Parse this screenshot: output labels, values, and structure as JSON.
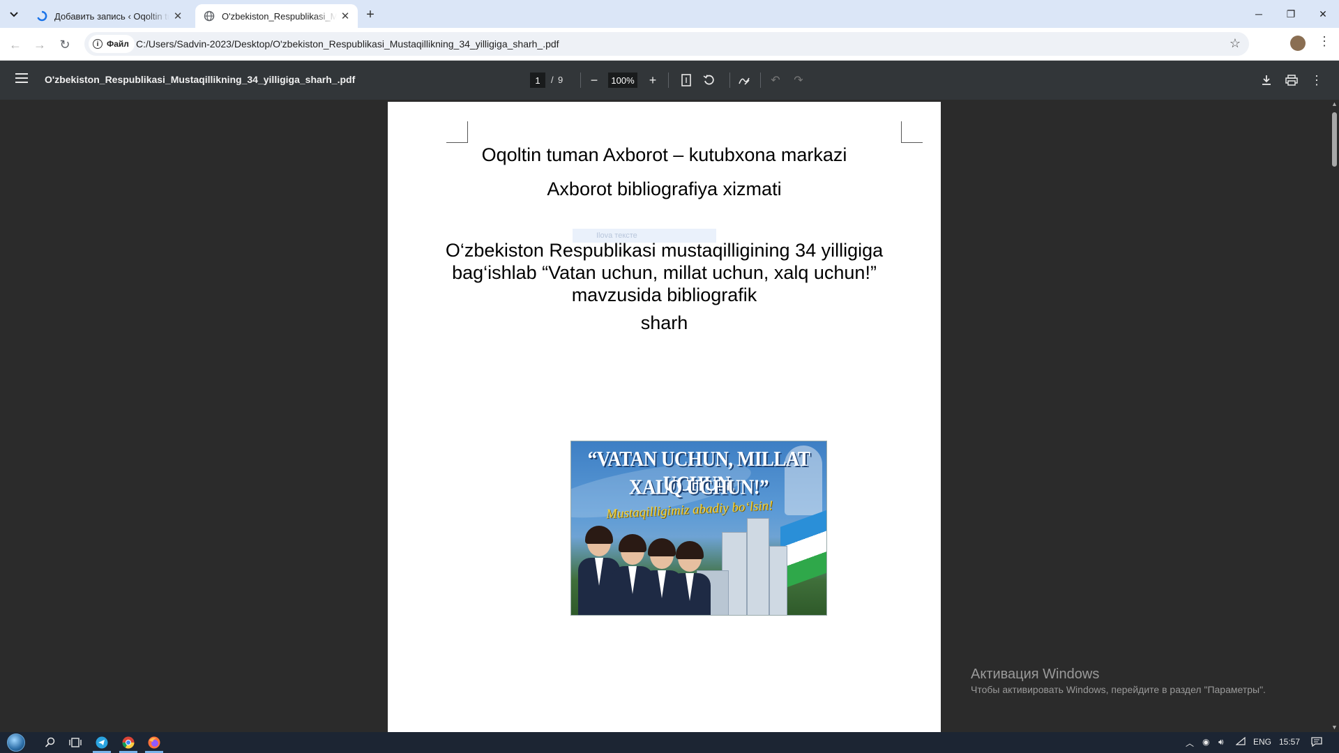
{
  "browser": {
    "tabs": [
      {
        "title": "Добавить запись ‹ Oqoltin tuman",
        "icon": "loading-spinner-icon",
        "active": false
      },
      {
        "title": "O'zbekiston_Respublikasi_Mustaqillikning_34_yilligiga_sharh_.pdf",
        "icon": "globe-icon",
        "active": true
      }
    ],
    "new_tab_label": "+",
    "window_controls": {
      "minimize": "─",
      "restore": "❐",
      "close": "✕"
    },
    "nav": {
      "back": "←",
      "forward": "→",
      "reload": "↻"
    },
    "omnibox": {
      "chip_label": "Файл",
      "url": "C:/Users/Sadvin-2023/Desktop/O'zbekiston_Respublikasi_Mustaqillikning_34_yilligiga_sharh_.pdf",
      "bookmark_icon": "☆"
    }
  },
  "pdf_viewer": {
    "title": "O'zbekiston_Respublikasi_Mustaqillikning_34_yilligiga_sharh_.pdf",
    "current_page": "1",
    "page_separator": "/",
    "total_pages": "9",
    "zoom": "100%",
    "zoom_out": "−",
    "zoom_in": "+"
  },
  "page_content": {
    "line1": "Oqoltin tuman  Axborot – kutubxona markazi",
    "line2": "Axborot  bibliografiya xizmati",
    "ghost_text": "Ilova тексте",
    "heading_line1": "O‘zbekiston Respublikasi mustaqilligining 34 yilligiga",
    "heading_line2": "bag‘ishlab  “Vatan uchun, millat uchun, xalq uchun!”",
    "heading_line3": "mavzusida  bibliografik",
    "heading_line4": "sharh",
    "poster": {
      "line1": "“VATAN UCHUN, MILLAT UCHUN,",
      "line2": "XALQ UCHUN!”",
      "line3": "Mustaqilligimiz abadiy bo‘lsin!"
    }
  },
  "activation": {
    "title": "Активация Windows",
    "subtitle": "Чтобы активировать Windows, перейдите в раздел \"Параметры\"."
  },
  "taskbar": {
    "language": "ENG",
    "time": "15:57"
  }
}
